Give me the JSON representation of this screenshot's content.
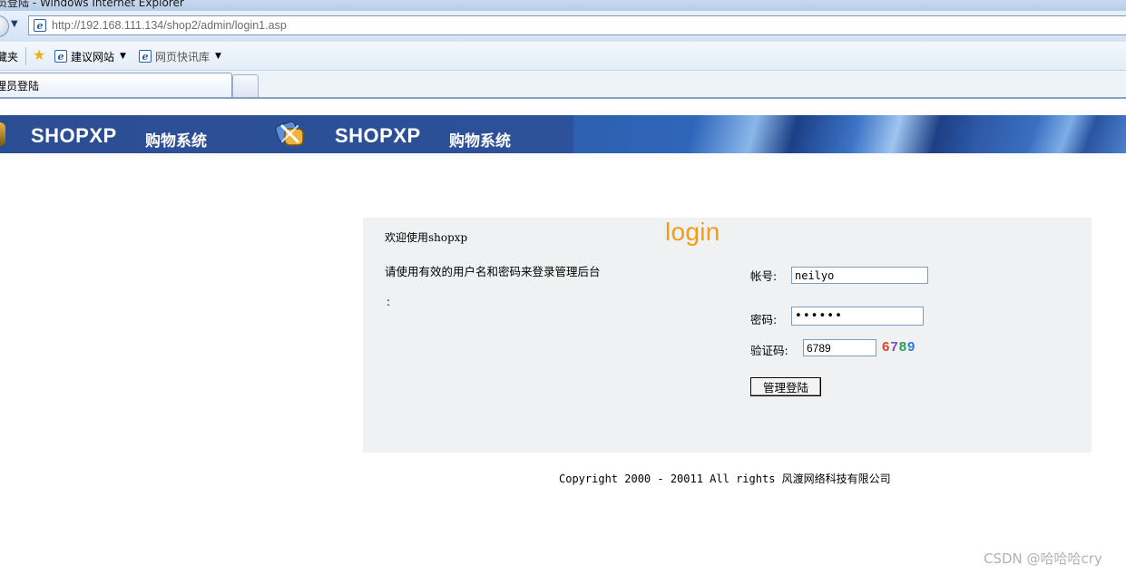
{
  "browser": {
    "window_title": "员登陆 - Windows Internet Explorer",
    "address_url": "http://192.168.111.134/shop2/admin/login1.asp",
    "favorites_cut_label": "藏夹",
    "favorites_items": [
      {
        "label": "建议网站",
        "icon": "ie-page-icon"
      },
      {
        "label": "网页快讯库",
        "icon": "ie-page-icon"
      }
    ],
    "active_tab_label": "理员登陆"
  },
  "header": {
    "brand_1": "SHOPXP",
    "brand_sub_1": "购物系统",
    "brand_2": "SHOPXP",
    "brand_sub_2": "购物系统"
  },
  "login": {
    "welcome_text": "欢迎使用shopxp",
    "instruction_text": "请使用有效的用户名和密码来登录管理后台",
    "colon_text": ":",
    "logo_word": "login",
    "account_label": "帐号:",
    "account_value": "neilyo",
    "password_label": "密码:",
    "password_value": "••••••",
    "captcha_label": "验证码:",
    "captcha_input_value": "6789",
    "captcha_digits": [
      "6",
      "7",
      "8",
      "9"
    ],
    "captcha_colors": [
      "#d8472a",
      "#7a4fb5",
      "#2e9c4e",
      "#2f7fd0"
    ],
    "submit_label": "管理登陆"
  },
  "footer": {
    "copyright_prefix": "Copyright 2000 - 20011 All rights",
    "company": "风渡网络科技有限公司"
  },
  "watermark": "CSDN @哈哈哈cry",
  "colors": {
    "banner": "#2b4e93",
    "login_word": "#f29d14",
    "panel_bg": "#eff1f2"
  }
}
